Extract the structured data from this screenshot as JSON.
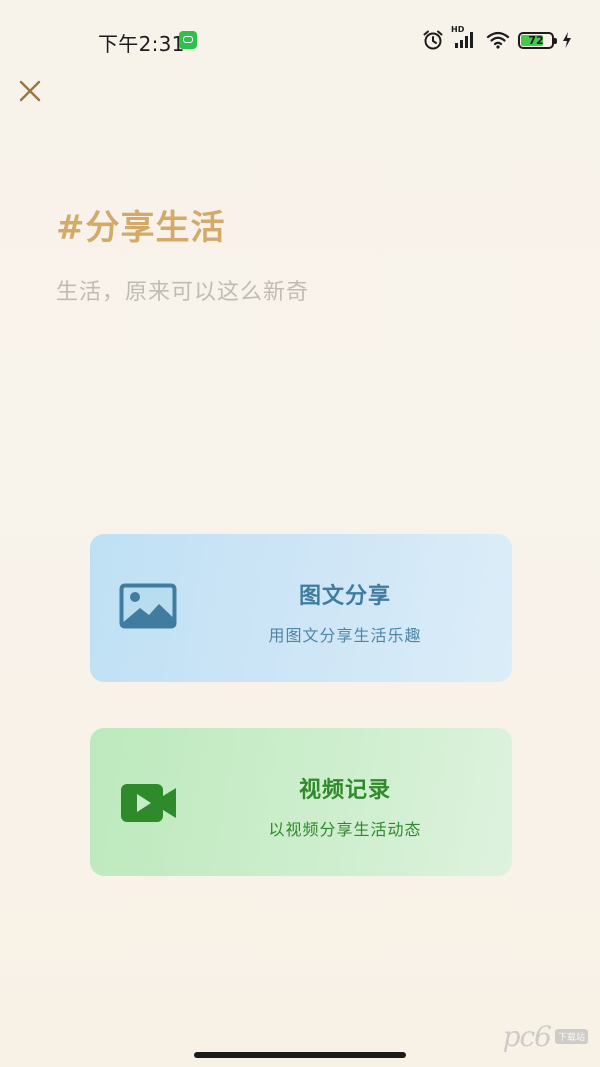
{
  "status_bar": {
    "time": "下午2:31",
    "network_label": "HD",
    "battery_level": "72",
    "battery_fraction": 0.72,
    "icons": [
      "alarm-icon",
      "signal-icon",
      "wifi-icon",
      "bolt-icon"
    ]
  },
  "header": {
    "close_icon": "close-icon",
    "title": "#分享生活",
    "subtitle": "生活，原来可以这么新奇"
  },
  "cards": [
    {
      "icon": "image-icon",
      "title": "图文分享",
      "description": "用图文分享生活乐趣",
      "color": "#3f7ca0"
    },
    {
      "icon": "video-camera-icon",
      "title": "视频记录",
      "description": "以视频分享生活动态",
      "color": "#2f8a2b"
    }
  ],
  "colors": {
    "accent": "#d3aa6a",
    "subtitle": "#c2bbb3",
    "photo_card": "#cfe6f6",
    "video_card": "#cdeecd"
  },
  "watermark": {
    "text": "pc6",
    "tag": "下载站"
  }
}
